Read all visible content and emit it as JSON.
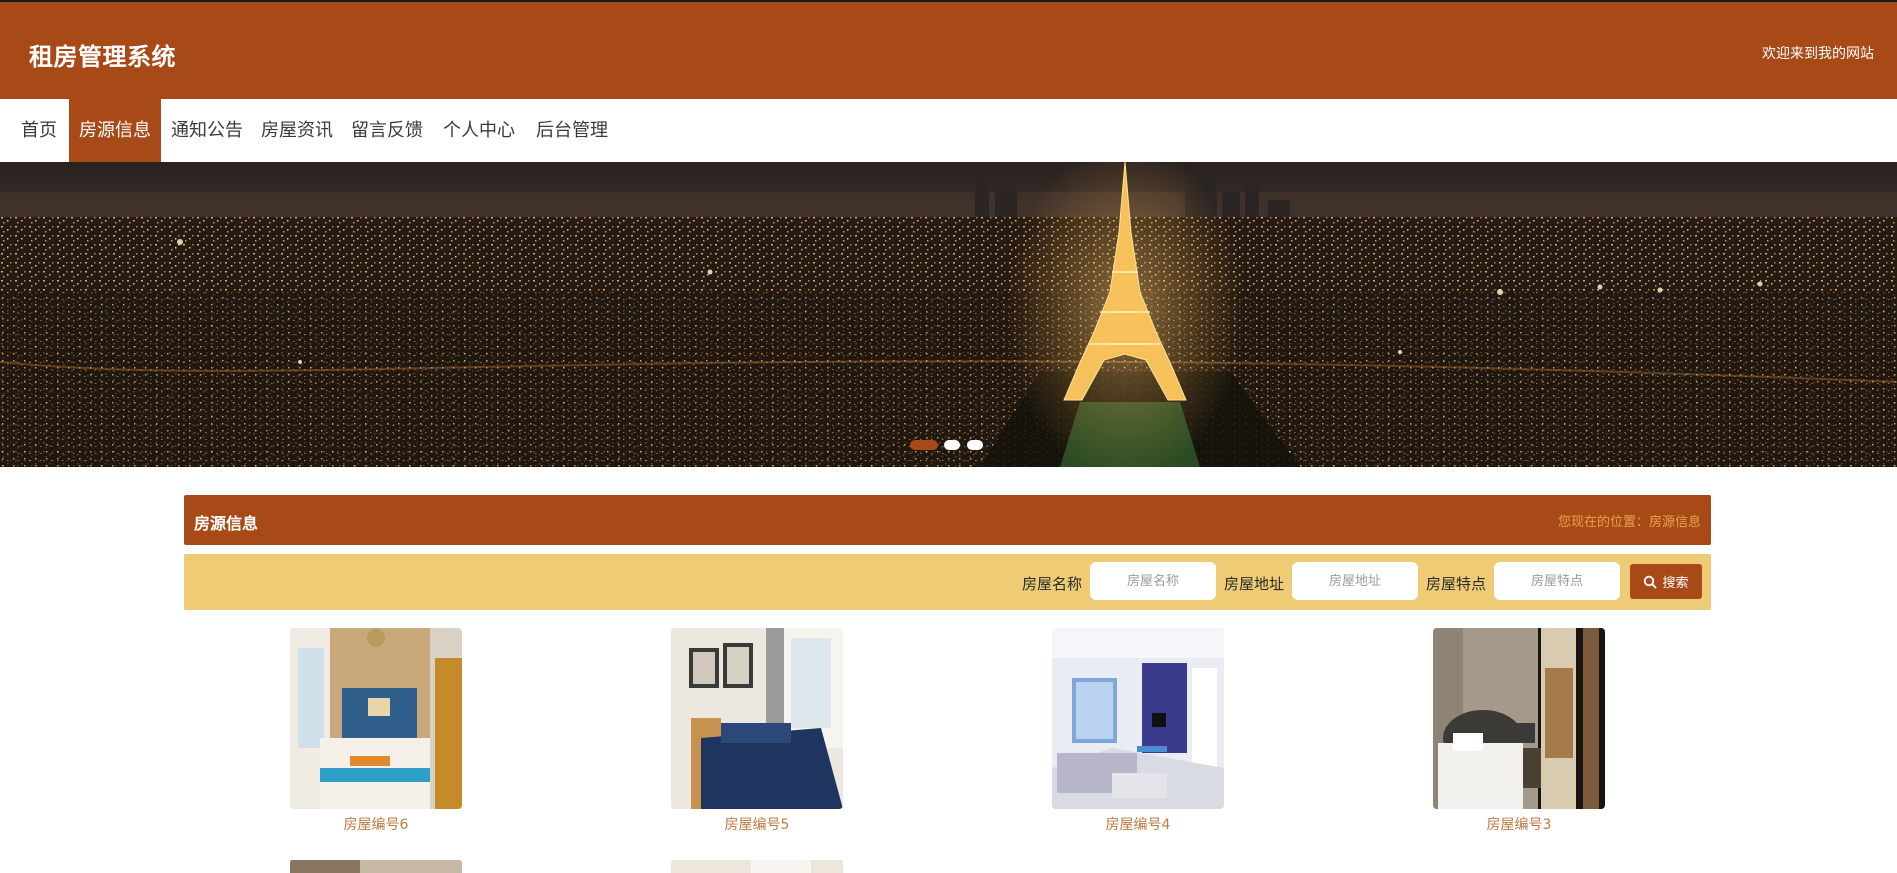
{
  "header": {
    "title": "租房管理系统",
    "welcome": "欢迎来到我的网站"
  },
  "nav": {
    "items": [
      {
        "label": "首页",
        "active": false
      },
      {
        "label": "房源信息",
        "active": true
      },
      {
        "label": "通知公告",
        "active": false
      },
      {
        "label": "房屋资讯",
        "active": false
      },
      {
        "label": "留言反馈",
        "active": false
      },
      {
        "label": "个人中心",
        "active": false
      },
      {
        "label": "后台管理",
        "active": false
      }
    ]
  },
  "banner": {
    "slide_count": 3,
    "active_slide": 1
  },
  "section": {
    "title": "房源信息",
    "breadcrumb": "您现在的位置：房源信息"
  },
  "search": {
    "name_label": "房屋名称",
    "name_placeholder": "房屋名称",
    "address_label": "房屋地址",
    "address_placeholder": "房屋地址",
    "feature_label": "房屋特点",
    "feature_placeholder": "房屋特点",
    "button_label": "搜索"
  },
  "listings": [
    {
      "name": "房屋编号6"
    },
    {
      "name": "房屋编号5"
    },
    {
      "name": "房屋编号4"
    },
    {
      "name": "房屋编号3"
    }
  ],
  "colors": {
    "primary": "#a84a18",
    "search_bar": "#eecb74",
    "breadcrumb": "#e8a34a",
    "listing_name": "#c07a45"
  }
}
